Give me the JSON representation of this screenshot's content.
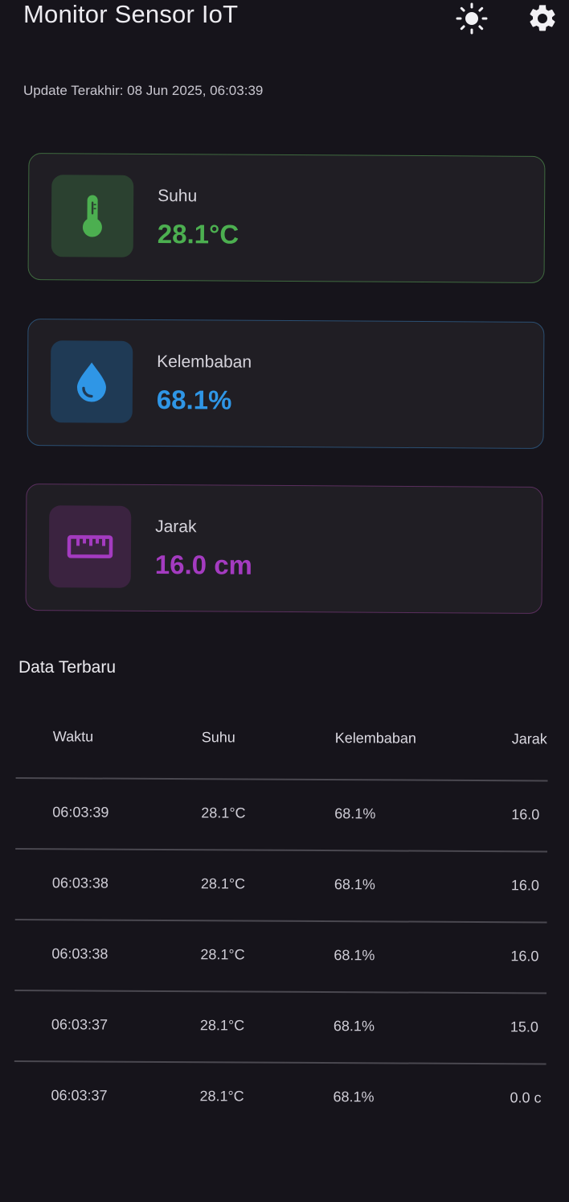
{
  "header": {
    "title": "Monitor Sensor IoT",
    "theme_icon": "sun-icon",
    "settings_icon": "gear-icon"
  },
  "last_update": "Update Terakhir: 08 Jun 2025, 06:03:39",
  "cards": {
    "suhu": {
      "label": "Suhu",
      "value": "28.1°C",
      "icon": "thermometer-icon",
      "color": "#4caf50"
    },
    "kelembaban": {
      "label": "Kelembaban",
      "value": "68.1%",
      "icon": "water-drop-icon",
      "color": "#2f96e6"
    },
    "jarak": {
      "label": "Jarak",
      "value": "16.0 cm",
      "icon": "ruler-icon",
      "color": "#a43bc0"
    }
  },
  "table": {
    "title": "Data Terbaru",
    "headers": [
      "Waktu",
      "Suhu",
      "Kelembaban",
      "Jarak"
    ],
    "rows": [
      [
        "06:03:39",
        "28.1°C",
        "68.1%",
        "16.0"
      ],
      [
        "06:03:38",
        "28.1°C",
        "68.1%",
        "16.0"
      ],
      [
        "06:03:38",
        "28.1°C",
        "68.1%",
        "16.0"
      ],
      [
        "06:03:37",
        "28.1°C",
        "68.1%",
        "15.0"
      ],
      [
        "06:03:37",
        "28.1°C",
        "68.1%",
        "0.0 c"
      ]
    ]
  }
}
